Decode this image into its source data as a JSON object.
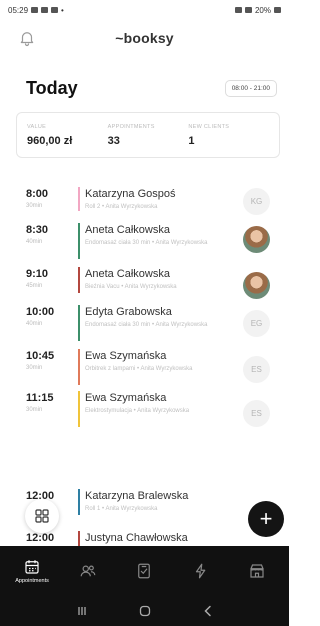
{
  "status_bar": {
    "time": "05:29",
    "battery": "20%"
  },
  "header": {
    "brand": "~booksy"
  },
  "today": {
    "title": "Today",
    "hours": "08:00 - 21:00"
  },
  "stats": [
    {
      "label": "VALUE",
      "value": "960,00 zł"
    },
    {
      "label": "APPOINTMENTS",
      "value": "33"
    },
    {
      "label": "NEW CLIENTS",
      "value": "1"
    }
  ],
  "appointments": [
    {
      "time": "8:00",
      "duration": "30min",
      "client": "Katarzyna Gospoś",
      "details": "Roll 2 • Anita Wyrzykowska",
      "avatar": "KG",
      "avatar_type": "initials",
      "color": "#f2a7c3"
    },
    {
      "time": "8:30",
      "duration": "40min",
      "client": "Aneta Całkowska",
      "details": "Endomasaż ciała 30 min • Anita Wyrzykowska",
      "avatar": "",
      "avatar_type": "photo",
      "color": "#3c8f6a"
    },
    {
      "time": "9:10",
      "duration": "45min",
      "client": "Aneta Całkowska",
      "details": "Bieźnia Vacu • Anita Wyrzykowska",
      "avatar": "",
      "avatar_type": "photo",
      "color": "#b3473f"
    },
    {
      "time": "10:00",
      "duration": "40min",
      "client": "Edyta Grabowska",
      "details": "Endomasaż ciała 30 min • Anita Wyrzykowska",
      "avatar": "EG",
      "avatar_type": "initials",
      "color": "#3c8f6a"
    },
    {
      "time": "10:45",
      "duration": "30min",
      "client": "Ewa Szymańska",
      "details": "Orbitrek z lampami • Anita Wyrzykowska",
      "avatar": "ES",
      "avatar_type": "initials",
      "color": "#e07a5a"
    },
    {
      "time": "11:15",
      "duration": "30min",
      "client": "Ewa Szymańska",
      "details": "Elektrostymulacja • Anita Wyrzykowska",
      "avatar": "ES",
      "avatar_type": "initials",
      "color": "#f0c43a"
    },
    {
      "time": "12:00",
      "duration": "",
      "client": "Katarzyna Bralewska",
      "details": "Roll 1 • Anita Wyrzykowska",
      "avatar": "",
      "avatar_type": "none",
      "color": "#2e7fa3"
    },
    {
      "time": "12:00",
      "duration": "",
      "client": "Justyna Chawłowska",
      "details": "",
      "avatar": "",
      "avatar_type": "none",
      "color": "#b3473f"
    }
  ],
  "bottom_nav": [
    {
      "label": "Appointments",
      "icon": "calendar-icon",
      "active": true
    },
    {
      "label": "",
      "icon": "clients-icon",
      "active": false
    },
    {
      "label": "",
      "icon": "checkout-icon",
      "active": false
    },
    {
      "label": "",
      "icon": "boost-icon",
      "active": false
    },
    {
      "label": "",
      "icon": "store-icon",
      "active": false
    }
  ],
  "fab_symbol": "+"
}
